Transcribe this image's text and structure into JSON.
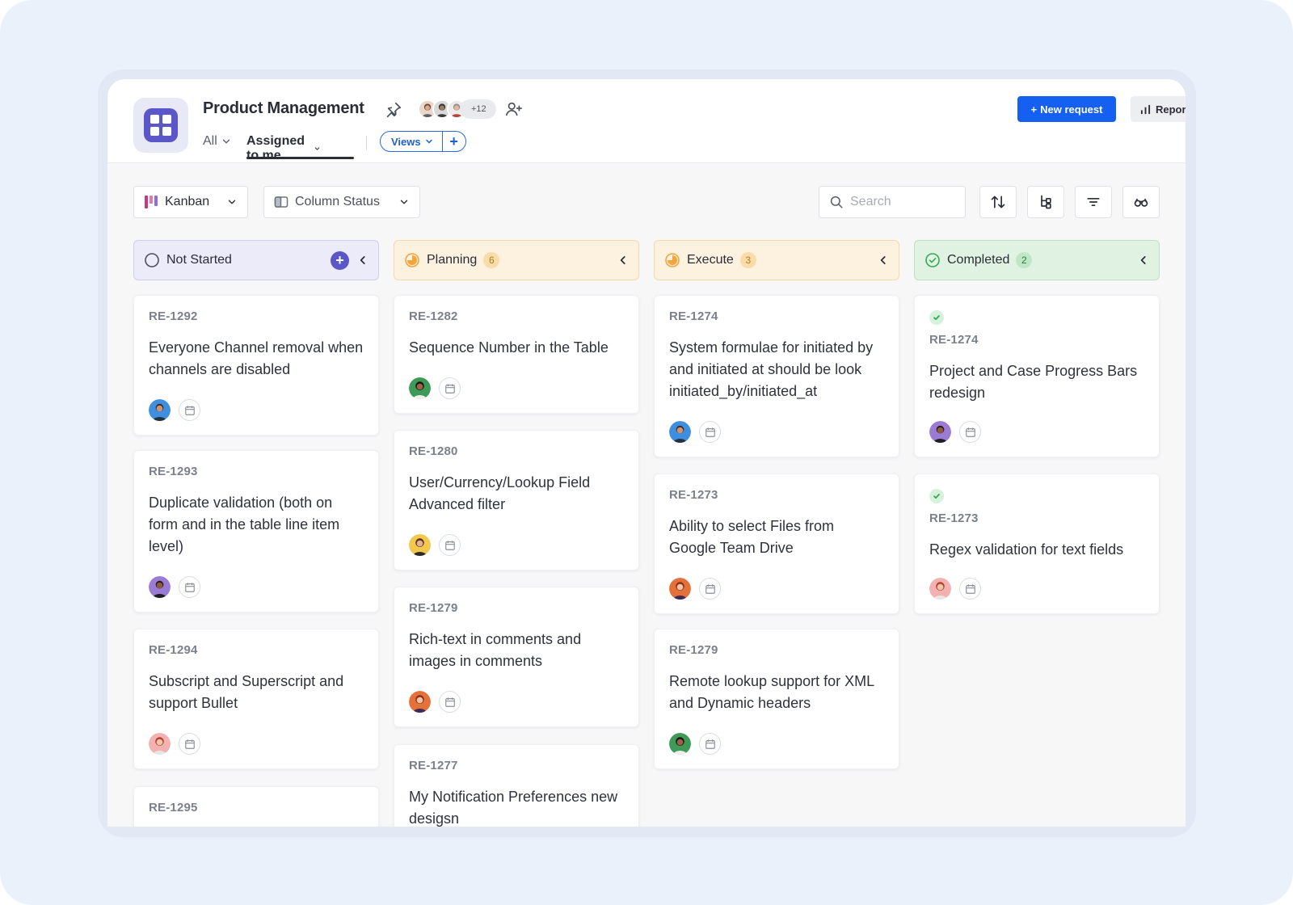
{
  "header": {
    "title": "Product Management",
    "members_more": "+12",
    "nav_all": "All",
    "nav_assigned": "Assigned to me",
    "views_label": "Views",
    "views_add": "+",
    "new_request": "New request",
    "reports": "Repor"
  },
  "toolbar": {
    "view_type": "Kanban",
    "column_by": "Column Status",
    "search_placeholder": "Search"
  },
  "colors": {
    "primary": "#1560f0",
    "app_accent": "#5b57c9",
    "planning": "#f4a43a",
    "completed": "#37a84f"
  },
  "columns": [
    {
      "name": "Not Started",
      "count": "",
      "cards": [
        {
          "id": "RE-1292",
          "title": "Everyone Channel removal when channels are disabled",
          "avatar": "blue"
        },
        {
          "id": "RE-1293",
          "title": "Duplicate validation (both on form and in the table line item level)",
          "avatar": "purple"
        },
        {
          "id": "RE-1294",
          "title": "Subscript and Superscript and support Bullet",
          "avatar": "pink"
        },
        {
          "id": "RE-1295",
          "title": "",
          "avatar": ""
        }
      ]
    },
    {
      "name": "Planning",
      "count": "6",
      "cards": [
        {
          "id": "RE-1282",
          "title": "Sequence Number in the Table",
          "avatar": "green"
        },
        {
          "id": "RE-1280",
          "title": "User/Currency/Lookup Field Advanced filter",
          "avatar": "yellow"
        },
        {
          "id": "RE-1279",
          "title": "Rich-text in comments and images in comments",
          "avatar": "orange"
        },
        {
          "id": "RE-1277",
          "title": "My Notification Preferences new desigsn",
          "avatar": ""
        }
      ]
    },
    {
      "name": "Execute",
      "count": "3",
      "cards": [
        {
          "id": "RE-1274",
          "title": "System formulae for initiated by and initiated at should be look initiated_by/initiated_at",
          "avatar": "blue"
        },
        {
          "id": "RE-1273",
          "title": "Ability to select Files from Google Team Drive",
          "avatar": "orange"
        },
        {
          "id": "RE-1279",
          "title": "Remote lookup support for XML and Dynamic headers",
          "avatar": "green"
        }
      ]
    },
    {
      "name": "Completed",
      "count": "2",
      "cards": [
        {
          "id": "RE-1274",
          "title": "Project and Case Progress Bars redesign",
          "avatar": "purple"
        },
        {
          "id": "RE-1273",
          "title": "Regex validation for text fields",
          "avatar": "pink"
        }
      ]
    }
  ]
}
